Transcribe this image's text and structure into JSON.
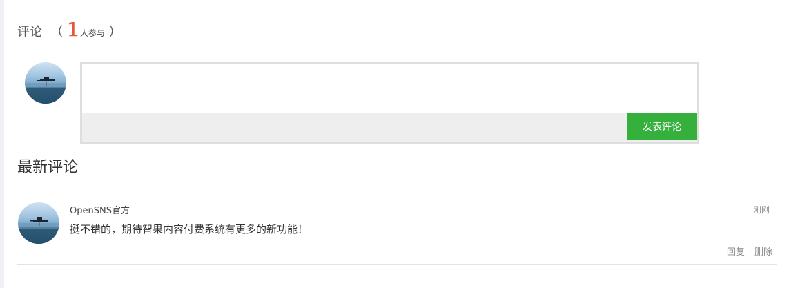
{
  "comments_header": {
    "title": "评论",
    "open_paren": "（",
    "count": "1",
    "count_suffix": "人参与",
    "close_paren": "）",
    "count_color": "#e8553a"
  },
  "editor": {
    "placeholder": "",
    "value": "",
    "submit_label": "发表评论",
    "submit_color": "#35b03d"
  },
  "latest": {
    "title": "最新评论",
    "items": [
      {
        "author": "OpenSNS官方",
        "text": "挺不错的，期待智果内容付费系统有更多的新功能！",
        "time": "刚刚",
        "reply_label": "回复",
        "delete_label": "删除",
        "avatar_icon": "user-avatar"
      }
    ]
  }
}
